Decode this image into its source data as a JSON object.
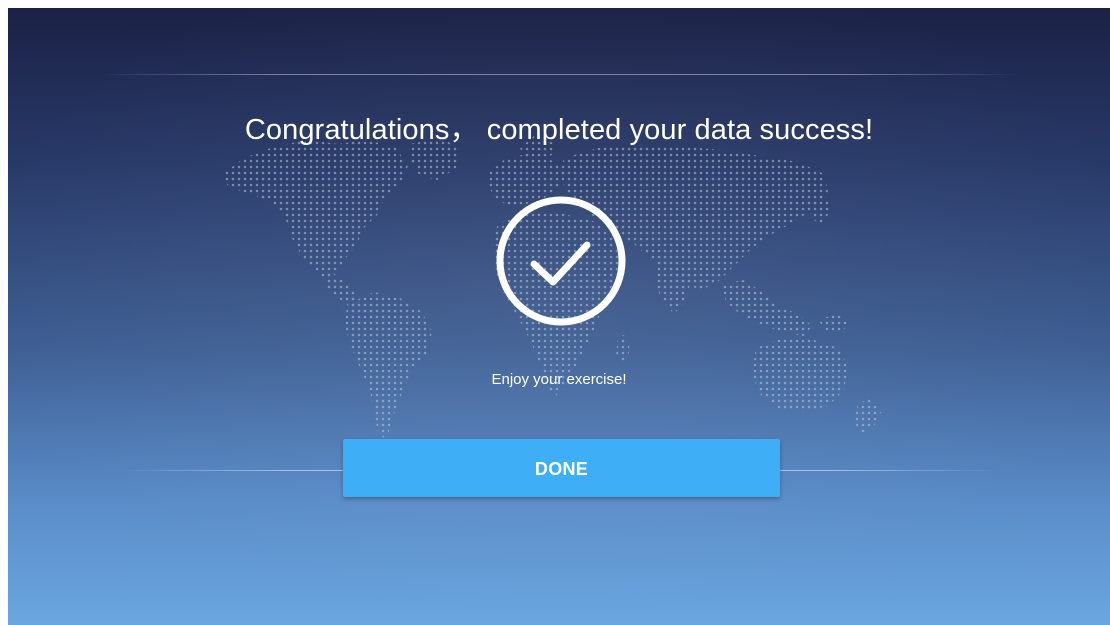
{
  "title": "Congratulations， completed your data success!",
  "message": "Enjoy your exercise!",
  "done_button": {
    "label": "DONE"
  },
  "icons": {
    "success": "checkmark-circle-icon",
    "background": "world-map-dotted"
  },
  "colors": {
    "background_top": "#1b2146",
    "background_bottom": "#6aa6e0",
    "button": "#3eaef7",
    "text": "#ffffff"
  }
}
